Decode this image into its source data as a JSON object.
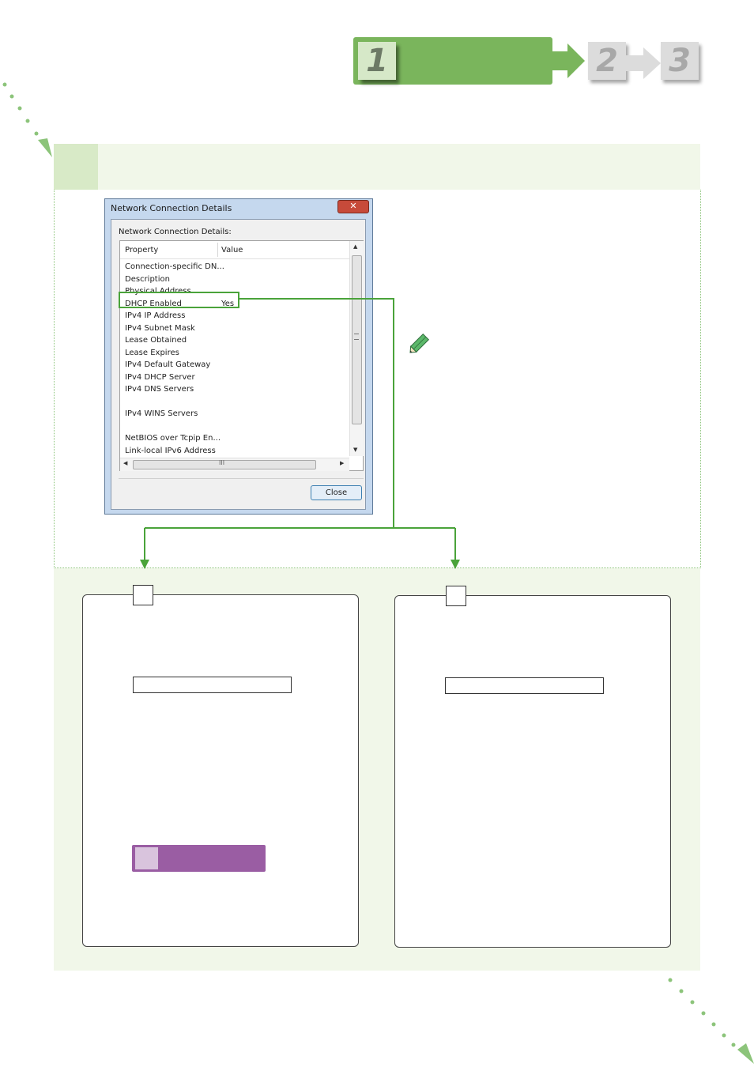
{
  "steps": {
    "current": "1",
    "next": [
      "2",
      "3"
    ]
  },
  "dialog": {
    "title": "Network Connection Details",
    "close_icon": "close-icon",
    "label": "Network Connection Details:",
    "columns": {
      "property": "Property",
      "value": "Value"
    },
    "rows": [
      {
        "property": "Connection-specific DN...",
        "value": ""
      },
      {
        "property": "Description",
        "value": ""
      },
      {
        "property": "Physical Address",
        "value": ""
      },
      {
        "property": "DHCP Enabled",
        "value": "Yes"
      },
      {
        "property": "IPv4 IP Address",
        "value": ""
      },
      {
        "property": "IPv4 Subnet Mask",
        "value": ""
      },
      {
        "property": "Lease Obtained",
        "value": ""
      },
      {
        "property": "Lease Expires",
        "value": ""
      },
      {
        "property": "IPv4 Default Gateway",
        "value": ""
      },
      {
        "property": "IPv4 DHCP Server",
        "value": ""
      },
      {
        "property": "IPv4 DNS Servers",
        "value": ""
      },
      {
        "property": "",
        "value": ""
      },
      {
        "property": "IPv4 WINS Servers",
        "value": ""
      },
      {
        "property": "",
        "value": ""
      },
      {
        "property": "NetBIOS over Tcpip En...",
        "value": ""
      },
      {
        "property": "Link-local IPv6 Address",
        "value": ""
      }
    ],
    "close_button": "Close",
    "hscroll_grip": "III"
  },
  "colors": {
    "accent_green": "#7ab55c",
    "highlight_green": "#4aa33a",
    "band": "#f1f7e9",
    "purple": "#9a5da3"
  },
  "icons": [
    "pencil-icon",
    "arrow-down-icon",
    "dotted-arrow-icon"
  ]
}
